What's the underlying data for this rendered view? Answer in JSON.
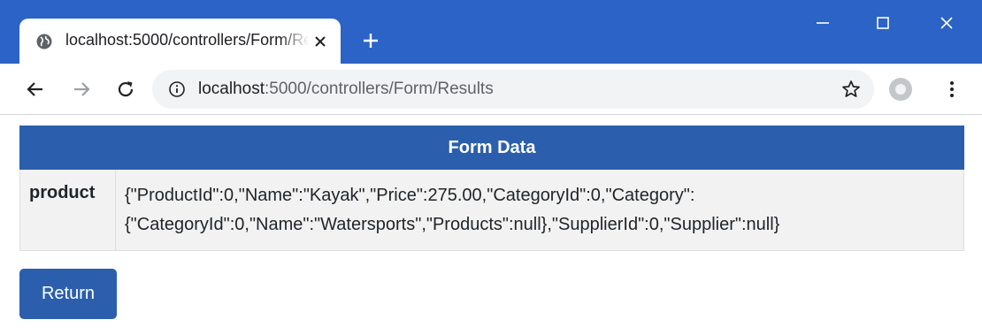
{
  "browser": {
    "tab_title": "localhost:5000/controllers/Form/Results",
    "url_host": "localhost",
    "url_path": ":5000/controllers/Form/Results"
  },
  "colors": {
    "titlebar": "#2b63c6",
    "primary": "#2b5fad",
    "cell_background": "#f2f2f2"
  },
  "icons": {
    "tab_favicon": "globe-icon",
    "tab_close": "close-icon",
    "new_tab": "plus-icon",
    "minimize": "minimize-icon",
    "maximize": "maximize-icon",
    "close_window": "close-icon",
    "back": "arrow-left-icon",
    "forward": "arrow-right-icon",
    "reload": "reload-icon",
    "site_info": "info-icon",
    "bookmark": "star-icon",
    "profile": "profile-icon",
    "menu": "kebab-menu-icon"
  },
  "page": {
    "table_header": "Form Data",
    "rows": [
      {
        "key": "product",
        "value_line1": "{\"ProductId\":0,\"Name\":\"Kayak\",\"Price\":275.00,\"CategoryId\":0,\"Category\":",
        "value_line2": "{\"CategoryId\":0,\"Name\":\"Watersports\",\"Products\":null},\"SupplierId\":0,\"Supplier\":null}"
      }
    ],
    "return_button": "Return"
  }
}
